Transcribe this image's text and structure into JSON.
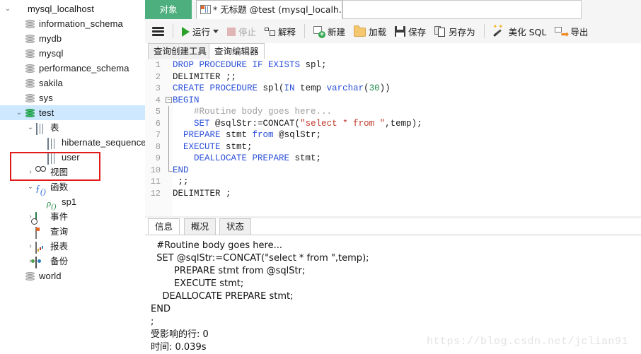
{
  "sidebar": {
    "nodes": [
      {
        "label": "mysql_localhost",
        "indent": 0,
        "twisty": "⌄",
        "icon": "connection-icon",
        "selected": false
      },
      {
        "label": "information_schema",
        "indent": 1,
        "twisty": "",
        "icon": "database-icon",
        "selected": false
      },
      {
        "label": "mydb",
        "indent": 1,
        "twisty": "",
        "icon": "database-icon",
        "selected": false
      },
      {
        "label": "mysql",
        "indent": 1,
        "twisty": "",
        "icon": "database-icon",
        "selected": false
      },
      {
        "label": "performance_schema",
        "indent": 1,
        "twisty": "",
        "icon": "database-icon",
        "selected": false
      },
      {
        "label": "sakila",
        "indent": 1,
        "twisty": "",
        "icon": "database-icon",
        "selected": false
      },
      {
        "label": "sys",
        "indent": 1,
        "twisty": "",
        "icon": "database-icon",
        "selected": false
      },
      {
        "label": "test",
        "indent": 1,
        "twisty": "⌄",
        "icon": "database-active-icon",
        "selected": true
      },
      {
        "label": "表",
        "indent": 2,
        "twisty": "⌄",
        "icon": "table-folder-icon",
        "selected": false
      },
      {
        "label": "hibernate_sequence",
        "indent": 3,
        "twisty": "",
        "icon": "table-icon",
        "selected": false
      },
      {
        "label": "user",
        "indent": 3,
        "twisty": "",
        "icon": "table-icon",
        "selected": false
      },
      {
        "label": "视图",
        "indent": 2,
        "twisty": "›",
        "icon": "view-icon",
        "selected": false
      },
      {
        "label": "函数",
        "indent": 2,
        "twisty": "⌄",
        "icon": "function-icon",
        "selected": false
      },
      {
        "label": "sp1",
        "indent": 3,
        "twisty": "",
        "icon": "procedure-icon",
        "selected": false
      },
      {
        "label": "事件",
        "indent": 2,
        "twisty": "›",
        "icon": "event-icon",
        "selected": false
      },
      {
        "label": "查询",
        "indent": 2,
        "twisty": "",
        "icon": "query-icon",
        "selected": false
      },
      {
        "label": "报表",
        "indent": 2,
        "twisty": "›",
        "icon": "report-icon",
        "selected": false
      },
      {
        "label": "备份",
        "indent": 2,
        "twisty": "›",
        "icon": "backup-icon",
        "selected": false
      },
      {
        "label": "world",
        "indent": 1,
        "twisty": "",
        "icon": "database-icon",
        "selected": false
      }
    ],
    "annotation_color": "#e01b1b"
  },
  "top_tabs": {
    "object_tab": "对象",
    "document_tab": "* 无标题 @test (mysql_localh...",
    "object_tab_color": "#4caf7d"
  },
  "toolbar": {
    "menu_label": "",
    "run": "运行",
    "stop": "停止",
    "explain": "解释",
    "new": "新建",
    "load": "加载",
    "save": "保存",
    "save_as": "另存为",
    "beautify_sql": "美化 SQL",
    "export": "导出"
  },
  "editor_tabs": {
    "builder": "查询创建工具",
    "editor": "查询编辑器",
    "active": "查询编辑器"
  },
  "code": {
    "lines": [
      {
        "n": "1",
        "segments": [
          {
            "t": "DROP PROCEDURE IF EXISTS ",
            "c": "kw"
          },
          {
            "t": "spl;",
            "c": "pl"
          }
        ]
      },
      {
        "n": "2",
        "segments": [
          {
            "t": "DELIMITER ;;",
            "c": "pl"
          }
        ]
      },
      {
        "n": "3",
        "segments": [
          {
            "t": "CREATE PROCEDURE ",
            "c": "kw"
          },
          {
            "t": "spl(",
            "c": "pl"
          },
          {
            "t": "IN ",
            "c": "kw"
          },
          {
            "t": "temp ",
            "c": "pl"
          },
          {
            "t": "varchar",
            "c": "kw"
          },
          {
            "t": "(",
            "c": "pl"
          },
          {
            "t": "30",
            "c": "num"
          },
          {
            "t": "))",
            "c": "pl"
          }
        ]
      },
      {
        "n": "4",
        "segments": [
          {
            "t": "BEGIN",
            "c": "kw"
          }
        ],
        "fold": "open"
      },
      {
        "n": "5",
        "segments": [
          {
            "t": "    #Routine body goes here...",
            "c": "cmt"
          }
        ]
      },
      {
        "n": "6",
        "segments": [
          {
            "t": "    ",
            "c": "pl"
          },
          {
            "t": "SET ",
            "c": "kw"
          },
          {
            "t": "@sqlStr:=CONCAT(",
            "c": "pl"
          },
          {
            "t": "\"select * from \"",
            "c": "str"
          },
          {
            "t": ",temp);",
            "c": "pl"
          }
        ]
      },
      {
        "n": "7",
        "segments": [
          {
            "t": "  ",
            "c": "pl"
          },
          {
            "t": "PREPARE ",
            "c": "kw"
          },
          {
            "t": "stmt ",
            "c": "pl"
          },
          {
            "t": "from ",
            "c": "kw"
          },
          {
            "t": "@sqlStr;",
            "c": "pl"
          }
        ]
      },
      {
        "n": "8",
        "segments": [
          {
            "t": "  ",
            "c": "pl"
          },
          {
            "t": "EXECUTE ",
            "c": "kw"
          },
          {
            "t": "stmt;",
            "c": "pl"
          }
        ]
      },
      {
        "n": "9",
        "segments": [
          {
            "t": "    ",
            "c": "pl"
          },
          {
            "t": "DEALLOCATE PREPARE ",
            "c": "kw"
          },
          {
            "t": "stmt;",
            "c": "pl"
          }
        ]
      },
      {
        "n": "10",
        "segments": [
          {
            "t": "END",
            "c": "kw"
          }
        ],
        "fold": "end"
      },
      {
        "n": "11",
        "segments": [
          {
            "t": " ;;",
            "c": "pl"
          }
        ]
      },
      {
        "n": "12",
        "segments": [
          {
            "t": "DELIMITER ;",
            "c": "pl"
          }
        ]
      }
    ]
  },
  "bottom_tabs": {
    "info": "信息",
    "profile": "概况",
    "status": "状态",
    "active": "信息"
  },
  "message": {
    "lines": [
      "  #Routine body goes here...",
      "  SET @sqlStr:=CONCAT(\"select * from \",temp);",
      "        PREPARE stmt from @sqlStr;",
      "        EXECUTE stmt;",
      "    DEALLOCATE PREPARE stmt;",
      "END",
      ";",
      "受影响的行: 0",
      "时间: 0.039s"
    ]
  },
  "watermark": "https://blog.csdn.net/jclian91"
}
